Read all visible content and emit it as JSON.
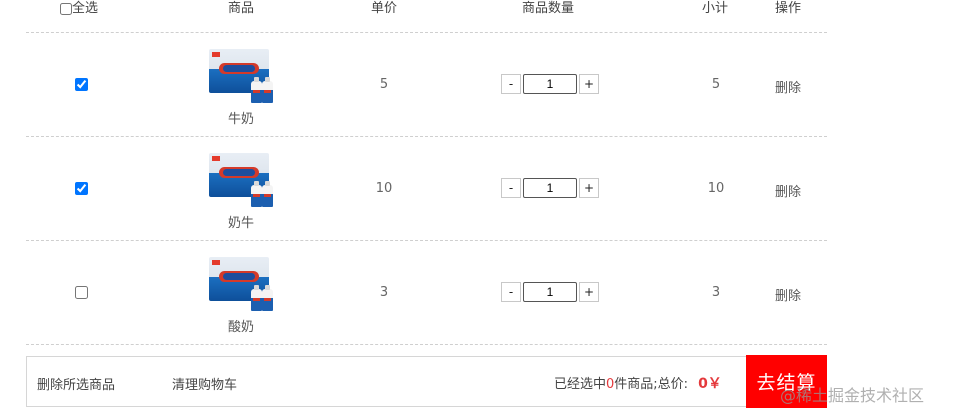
{
  "header": {
    "select_all": "全选",
    "product": "商品",
    "unit_price": "单价",
    "quantity": "商品数量",
    "subtotal": "小计",
    "action": "操作"
  },
  "items": [
    {
      "checked": true,
      "name": "牛奶",
      "price": "5",
      "qty": "1",
      "subtotal": "5",
      "delete": "删除"
    },
    {
      "checked": true,
      "name": "奶牛",
      "price": "10",
      "qty": "1",
      "subtotal": "10",
      "delete": "删除"
    },
    {
      "checked": false,
      "name": "酸奶",
      "price": "3",
      "qty": "1",
      "subtotal": "3",
      "delete": "删除"
    }
  ],
  "qty_controls": {
    "minus": "-",
    "plus": "+"
  },
  "footer": {
    "delete_selected": "删除所选商品",
    "clear_cart": "清理购物车",
    "summary_prefix": "已经选中",
    "selected_count": "0",
    "summary_mid": "件商品;总价:",
    "total": "0￥",
    "checkout": "去结算"
  },
  "watermark": "@稀土掘金技术社区",
  "colors": {
    "accent_red": "#ff0000",
    "price_red": "#e4393c"
  },
  "select_all_checked": false
}
